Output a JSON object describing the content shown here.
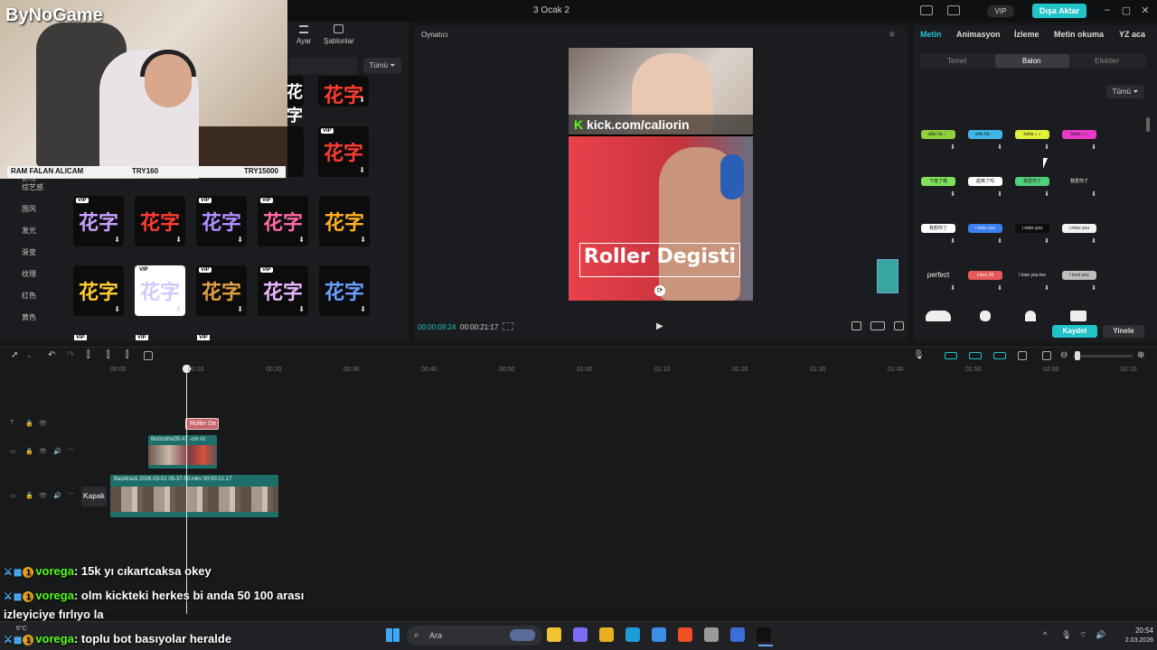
{
  "window": {
    "title": "3 Ocak 2",
    "vip_label": "VIP",
    "export_label": "Dışa Aktar",
    "controls": [
      "–",
      "▢",
      "✕"
    ]
  },
  "overlay": {
    "logo_text": "ByNoGame",
    "ticker": {
      "item": "RAM FALAN ALICAM",
      "current": "TRY160",
      "goal": "TRY15000"
    }
  },
  "left_panel": {
    "tools": {
      "adjust": "Ayar",
      "templates": "Şablonlar"
    },
    "filter_label": "Tümü",
    "categories": [
      "综艺感",
      "国风",
      "发光",
      "渐变",
      "纹理",
      "红色",
      "黄色"
    ],
    "partial_category": "影视",
    "sticker_glyph": "花字",
    "sticker_glyph_top": "花字",
    "vip_tag": "VIP",
    "download_glyph": "⬇",
    "stickers_row1": [
      {
        "vip": true,
        "style": "purple"
      },
      {
        "vip": false,
        "style": "red"
      },
      {
        "vip": true,
        "style": "violet"
      },
      {
        "vip": true,
        "style": "rainbow"
      },
      {
        "vip": false,
        "style": "orange"
      }
    ],
    "stickers_row2": [
      {
        "vip": false,
        "style": "gold"
      },
      {
        "vip": true,
        "style": "white"
      },
      {
        "vip": true,
        "style": "bronze"
      },
      {
        "vip": true,
        "style": "pastel"
      },
      {
        "vip": false,
        "style": "blue"
      }
    ]
  },
  "player": {
    "title": "Oynatıcı",
    "overlay_text": "Roller Degisti",
    "kick_url": "kick.com/caliorin",
    "kick_k": "K",
    "time_current": "00:00:09:24",
    "time_total": "00:00:21:17",
    "play_icon": "▶",
    "menu_icon": "≡",
    "rotate_icon": "⟳"
  },
  "right_panel": {
    "tabs": [
      "Metin",
      "Animasyon",
      "İzleme",
      "Metin okuma",
      "YZ aca"
    ],
    "subtabs": [
      "Temel",
      "Balon",
      "Efektler"
    ],
    "filter_label": "Tümü",
    "bubbles_row1": [
      {
        "text": "whk hb ♩",
        "color": "#8fcf3c"
      },
      {
        "text": "whk hb ♩",
        "color": "#3fb6e6"
      },
      {
        "text": "hehe ♪ ♪",
        "color": "#e2f03a"
      },
      {
        "text": "hehe ♪ ♪",
        "color": "#e83ac7"
      }
    ],
    "bubbles_row2": [
      {
        "text": "下班了哦",
        "color": "#7fe05a"
      },
      {
        "text": "超爽了吗",
        "color": "#ffffff"
      },
      {
        "text": "我爱你了",
        "color": "#4fcf7a"
      },
      {
        "text": "我爱你了",
        "color": "#1b1c1f"
      }
    ],
    "bubbles_row3": [
      {
        "text": "我想你了",
        "color": "#ffffff"
      },
      {
        "text": "i miss you",
        "color": "#3b7ff0"
      },
      {
        "text": "i miss you",
        "color": "#0c0c0d"
      },
      {
        "text": "i miss you",
        "color": "#f2f2f2"
      }
    ],
    "bubbles_row4": [
      {
        "text": "perfect",
        "color": "#1b1c1f"
      },
      {
        "text": "Likes 99",
        "color": "#e85a5a"
      },
      {
        "text": "I love you too",
        "color": "#1b1c1f"
      },
      {
        "text": "I love you",
        "color": "#bdbdbd"
      }
    ],
    "save_label": "Kaydet",
    "reset_label": "Yinele"
  },
  "timeline": {
    "ruler_labels": [
      "00:00",
      "00:10",
      "00:20",
      "00:30",
      "00:40",
      "00:50",
      "01:00",
      "01:10",
      "01:20",
      "01:30",
      "01:40",
      "01:50",
      "02:00",
      "02:10"
    ],
    "text_clip_label": "Roller De",
    "video_clip_label": "6ts0zdmx05  AT -cm  nz",
    "main_clip_label": "Backtrack 2026-03-02 05-37-50.mkv  00:00:21:17",
    "cover_label": "Kapak"
  },
  "chat": [
    {
      "user": "vorega",
      "message": "15k yı cıkartcaksa okey"
    },
    {
      "user": "vorega",
      "message": "olm kickteki herkes bi anda 50 100 arası"
    },
    {
      "user": "",
      "message": "izleyiciye fırlıyo la"
    },
    {
      "user": "vorega",
      "message": "toplu bot basıyolar heralde"
    }
  ],
  "chat_badge": "1",
  "taskbar": {
    "search_placeholder": "Ara",
    "weather": "6°C",
    "time": "20:54",
    "date": "2.03.2026",
    "apps": [
      {
        "name": "file-explorer",
        "color": "#f1c232"
      },
      {
        "name": "copilot",
        "color": "#7a6cf0"
      },
      {
        "name": "folder",
        "color": "#e8b021"
      },
      {
        "name": "edge",
        "color": "#1d9bd8"
      },
      {
        "name": "store",
        "color": "#3a8ee6"
      },
      {
        "name": "brave",
        "color": "#f04f23"
      },
      {
        "name": "settings",
        "color": "#9a9a9a"
      },
      {
        "name": "app-blue",
        "color": "#3b6fd6"
      },
      {
        "name": "capcut",
        "color": "#111111"
      }
    ]
  },
  "colors": {
    "accent": "#1fc3c8",
    "chat_user": "#53fc18",
    "kick_green": "#53fc18",
    "text_clip": "#c5656b",
    "video_clip": "#1e6f69"
  }
}
